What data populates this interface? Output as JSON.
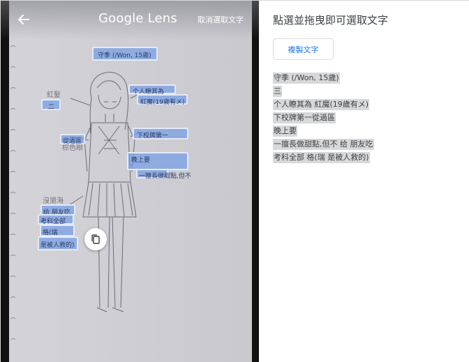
{
  "app": {
    "title": "Google Lens",
    "cancel_selection": "取消選取文字"
  },
  "panel": {
    "title": "點選並拖曳即可選取文字",
    "copy_button": "複製文字"
  },
  "extracted_lines": [
    "守季 (/Won, 15歲)",
    "三",
    "个人瞭其為 紅魔(19歲有メ)",
    "下校牌第一從過區",
    "晚上要",
    "一擅長做甜點,但不 给 朋友吃",
    "考科全部 格(瑞 是被人救的)"
  ],
  "image_highlights": {
    "h1": "守季 (/Won, 15歲)",
    "h2": "二",
    "h3": "个人瞭其為",
    "h4": "紅魔(19歲有メ)",
    "h5": "下校牌第一",
    "h6": "從過區",
    "h7": "晚上要",
    "h8": "一擅長做甜點,但不",
    "h9": "给 朋友吃",
    "h10": "考科全部",
    "h11": "格(瑞",
    "h12": "是被人救的)"
  },
  "icons": {
    "back": "arrow-left-icon",
    "copy_fab": "copy-icon"
  },
  "colors": {
    "highlight": "#7aa0e6",
    "link_blue": "#1a73e8",
    "selection_bg": "#d7d8da"
  }
}
